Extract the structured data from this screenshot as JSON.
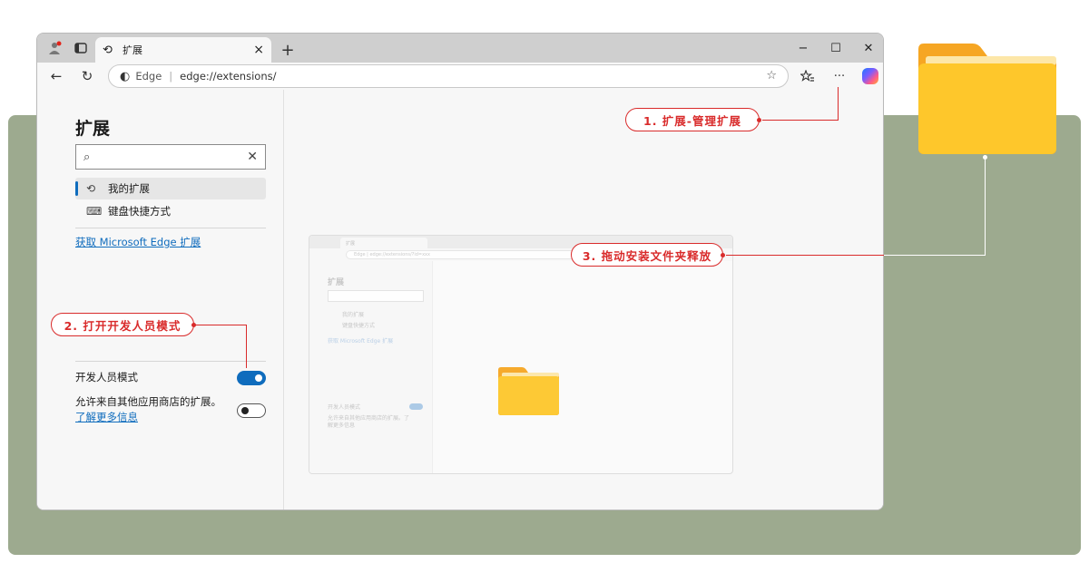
{
  "browser": {
    "tab": {
      "title": "扩展",
      "close": "×"
    },
    "new_tab": "+",
    "window_controls": {
      "minimize": "−",
      "maximize": "☐",
      "close": "✕"
    },
    "nav": {
      "back": "←",
      "refresh": "↻"
    },
    "address": {
      "site_label": "Edge",
      "separator": "|",
      "url": "edge://extensions/"
    },
    "toolbar_icons": [
      "favorites-icon",
      "more-icon",
      "copilot-icon"
    ],
    "more_label": "···"
  },
  "sidebar": {
    "title": "扩展",
    "search": {
      "value": "",
      "placeholder": ""
    },
    "items": [
      {
        "label": "我的扩展",
        "icon": "puzzle-icon",
        "active": true
      },
      {
        "label": "键盘快捷方式",
        "icon": "keyboard-icon",
        "active": false
      }
    ],
    "get_link": "获取 Microsoft Edge 扩展",
    "developer_mode": {
      "label": "开发人员模式",
      "enabled": true
    },
    "allow_other_stores": {
      "label": "允许来自其他应用商店的扩展。",
      "link": "了解更多信息",
      "enabled": false
    }
  },
  "mini_preview": {
    "tab_title": "扩展",
    "address": "Edge | edge://extensions/?id=xxx",
    "title": "扩展",
    "items": [
      "我的扩展",
      "键盘快捷方式"
    ],
    "get_link": "获取 Microsoft Edge 扩展",
    "developer_mode": "开发人员模式",
    "allow_other": "允许来自其他应用商店的扩展。了解更多信息"
  },
  "callouts": {
    "step1": "1. 扩展-管理扩展",
    "step2": "2. 打开开发人员模式",
    "step3": "3. 拖动安装文件夹释放"
  },
  "colors": {
    "accent": "#0f6cbd",
    "callout": "#d92b2b",
    "background_panel": "#9daa8f",
    "folder": "#fec72b"
  }
}
